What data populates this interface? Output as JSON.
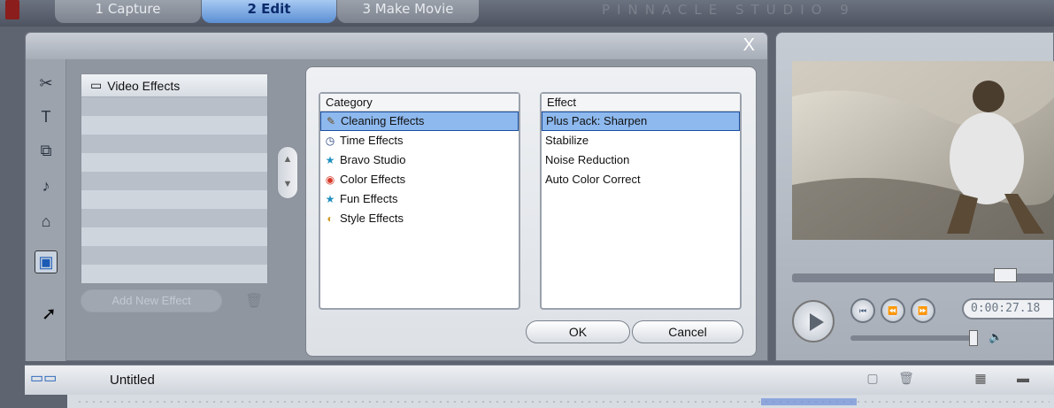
{
  "tabs": [
    {
      "label": "1 Capture"
    },
    {
      "label": "2 Edit"
    },
    {
      "label": "3 Make Movie"
    }
  ],
  "app_title": "PINNACLE STUDIO 9",
  "panel": {
    "close_label": "X",
    "video_effects_header": "Video Effects",
    "add_effect_label": "Add New Effect"
  },
  "dialog": {
    "category_header": "Category",
    "effect_header": "Effect",
    "categories": [
      {
        "label": "Cleaning Effects",
        "icon": "broom-icon",
        "selected": true
      },
      {
        "label": "Time Effects",
        "icon": "clock-icon"
      },
      {
        "label": "Bravo Studio",
        "icon": "star-icon"
      },
      {
        "label": "Color Effects",
        "icon": "color-wheel-icon"
      },
      {
        "label": "Fun Effects",
        "icon": "star-icon"
      },
      {
        "label": "Style Effects",
        "icon": "palette-icon"
      }
    ],
    "effects": [
      {
        "label": "Plus Pack: Sharpen",
        "selected": true
      },
      {
        "label": "Stabilize"
      },
      {
        "label": "Noise Reduction"
      },
      {
        "label": "Auto Color Correct"
      }
    ],
    "ok_label": "OK",
    "cancel_label": "Cancel"
  },
  "player": {
    "timecode": "0:00:27.18"
  },
  "timeline": {
    "project_title": "Untitled"
  }
}
